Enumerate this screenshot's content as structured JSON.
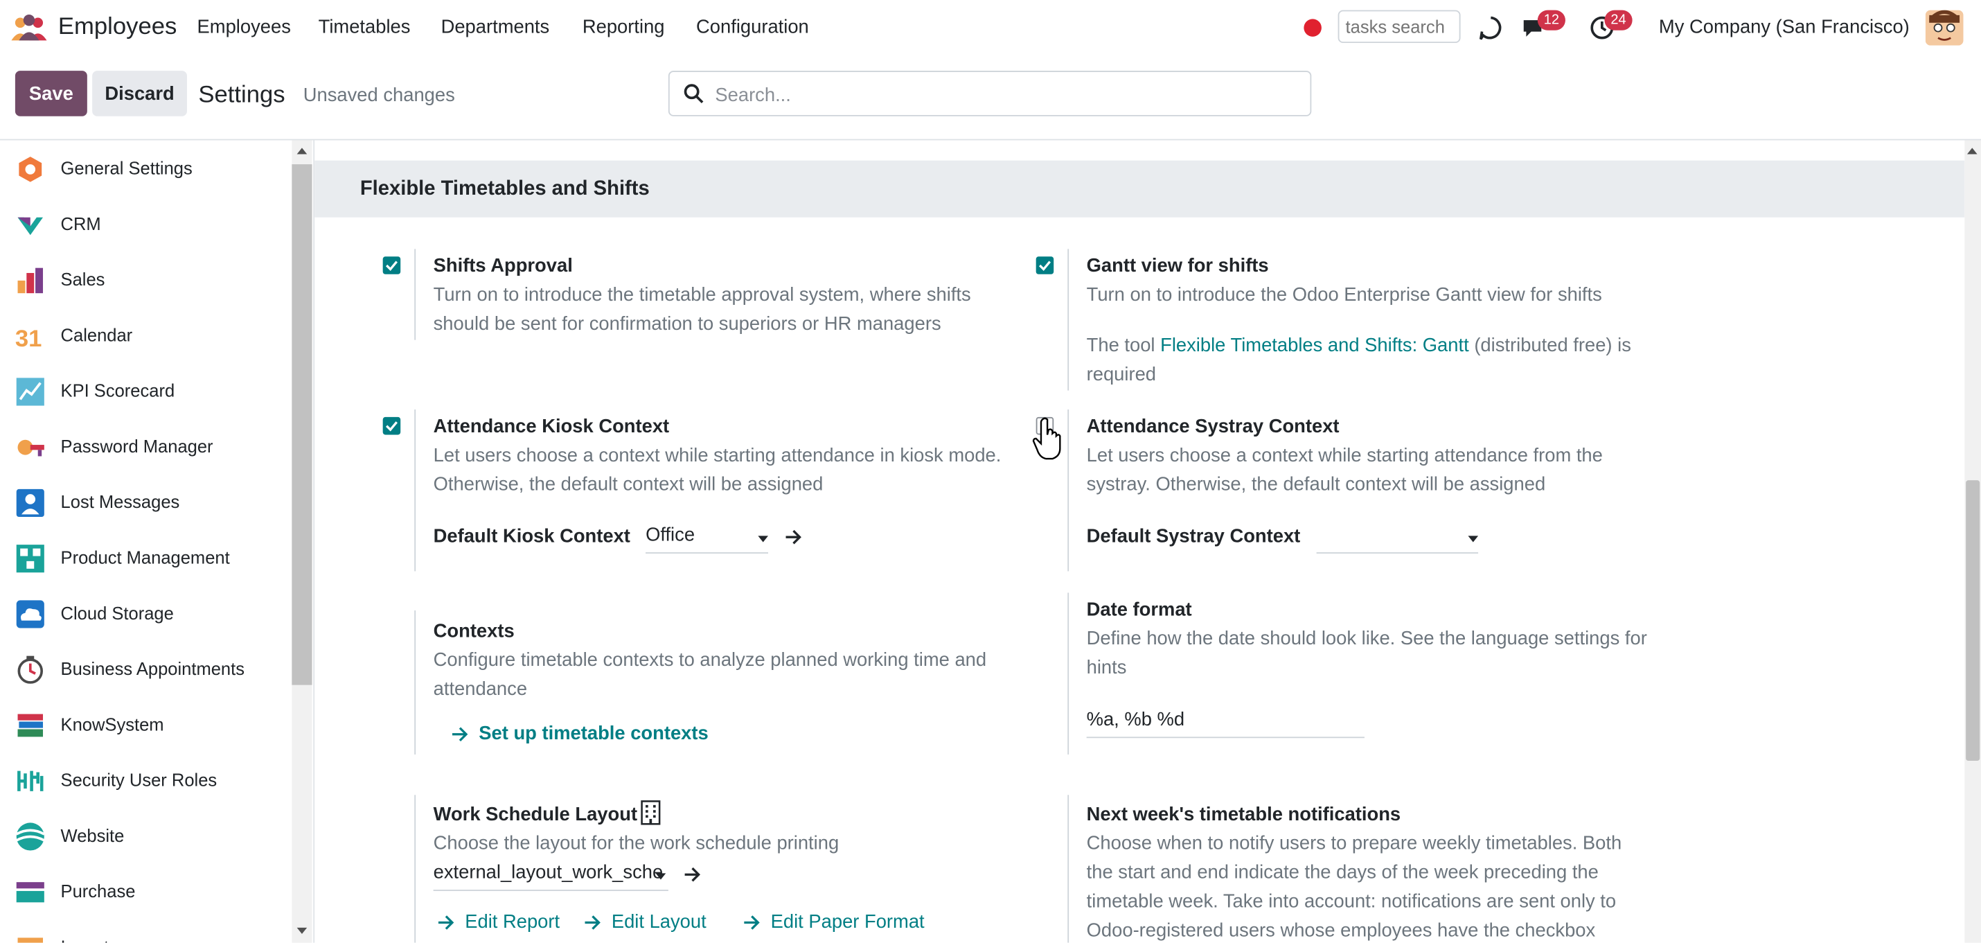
{
  "topnav": {
    "app_name": "Employees",
    "menu": [
      "Employees",
      "Timetables",
      "Departments",
      "Reporting",
      "Configuration"
    ],
    "tasks_search_placeholder": "tasks search",
    "messages_count": "12",
    "activities_count": "24",
    "company": "My Company (San Francisco)"
  },
  "control": {
    "save_label": "Save",
    "discard_label": "Discard",
    "title": "Settings",
    "unsaved": "Unsaved changes",
    "search_placeholder": "Search..."
  },
  "sidebar": {
    "items": [
      {
        "label": "General Settings",
        "icon": "general-settings-icon"
      },
      {
        "label": "CRM",
        "icon": "crm-icon"
      },
      {
        "label": "Sales",
        "icon": "sales-icon"
      },
      {
        "label": "Calendar",
        "icon": "calendar-icon",
        "icon_text": "31"
      },
      {
        "label": "KPI Scorecard",
        "icon": "kpi-scorecard-icon"
      },
      {
        "label": "Password Manager",
        "icon": "password-manager-icon"
      },
      {
        "label": "Lost Messages",
        "icon": "lost-messages-icon"
      },
      {
        "label": "Product Management",
        "icon": "product-management-icon"
      },
      {
        "label": "Cloud Storage",
        "icon": "cloud-storage-icon"
      },
      {
        "label": "Business Appointments",
        "icon": "business-appointments-icon"
      },
      {
        "label": "KnowSystem",
        "icon": "knowsystem-icon"
      },
      {
        "label": "Security User Roles",
        "icon": "security-user-roles-icon"
      },
      {
        "label": "Website",
        "icon": "website-icon"
      },
      {
        "label": "Purchase",
        "icon": "purchase-icon"
      },
      {
        "label": "Inventory",
        "icon": "inventory-icon"
      }
    ]
  },
  "section": {
    "title": "Flexible Timetables and Shifts",
    "shifts_approval": {
      "title": "Shifts Approval",
      "desc": "Turn on to introduce the timetable approval system, where shifts should be sent for confirmation to superiors or HR managers",
      "checked": true
    },
    "gantt": {
      "title": "Gantt view for shifts",
      "desc": "Turn on to introduce the Odoo Enterprise Gantt view for shifts",
      "note_prefix": "The tool ",
      "note_link": "Flexible Timetables and Shifts: Gantt",
      "note_suffix": " (distributed free) is required",
      "checked": true
    },
    "kiosk": {
      "title": "Attendance Kiosk Context",
      "desc": "Let users choose a context while starting attendance in kiosk mode. Otherwise, the default context will be assigned",
      "checked": true,
      "field_label": "Default Kiosk Context",
      "field_value": "Office"
    },
    "systray": {
      "title": "Attendance Systray Context",
      "desc": "Let users choose a context while starting attendance from the systray. Otherwise, the default context will be assigned",
      "checked": false,
      "field_label": "Default Systray Context",
      "field_value": ""
    },
    "contexts": {
      "title": "Contexts",
      "desc": "Configure timetable contexts to analyze planned working time and attendance",
      "link": "Set up timetable contexts"
    },
    "date_format": {
      "title": "Date format",
      "desc": "Define how the date should look like. See the language settings for hints",
      "value": "%a, %b %d"
    },
    "work_schedule": {
      "title": "Work Schedule Layout",
      "desc": "Choose the layout for the work schedule printing",
      "value": "external_layout_work_sche",
      "edit_report": "Edit Report",
      "edit_layout": "Edit Layout",
      "edit_paper": "Edit Paper Format"
    },
    "notifications": {
      "title": "Next week's timetable notifications",
      "desc": "Choose when to notify users to prepare weekly timetables. Both the start and end indicate the days of the week preceding the timetable week. Take into account: notifications are sent only to Odoo-registered users whose employees have the checkbox"
    }
  },
  "colors": {
    "brand": "#714b67",
    "accent": "#017e84",
    "badge": "#d0334a",
    "record": "#e0212f"
  }
}
